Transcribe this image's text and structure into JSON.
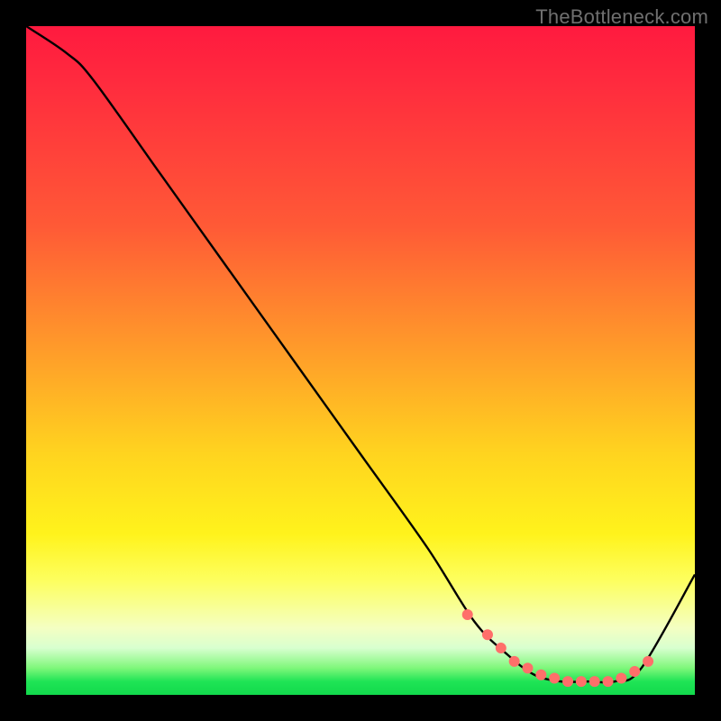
{
  "watermark": "TheBottleneck.com",
  "chart_data": {
    "type": "line",
    "title": "",
    "xlabel": "",
    "ylabel": "",
    "xlim": [
      0,
      100
    ],
    "ylim": [
      0,
      100
    ],
    "series": [
      {
        "name": "curve",
        "x": [
          0,
          6,
          10,
          20,
          30,
          40,
          50,
          60,
          67,
          72,
          76,
          80,
          84,
          88,
          92,
          100
        ],
        "y": [
          100,
          96,
          92,
          78,
          64,
          50,
          36,
          22,
          11,
          6,
          3,
          2,
          2,
          2,
          4,
          18
        ]
      }
    ],
    "markers": {
      "name": "dots",
      "x": [
        66,
        69,
        71,
        73,
        75,
        77,
        79,
        81,
        83,
        85,
        87,
        89,
        91,
        93
      ],
      "y": [
        12,
        9,
        7,
        5,
        4,
        3,
        2.5,
        2,
        2,
        2,
        2,
        2.5,
        3.5,
        5
      ]
    },
    "colors": {
      "curve": "#000000",
      "markers": "#ff6f6a"
    }
  }
}
